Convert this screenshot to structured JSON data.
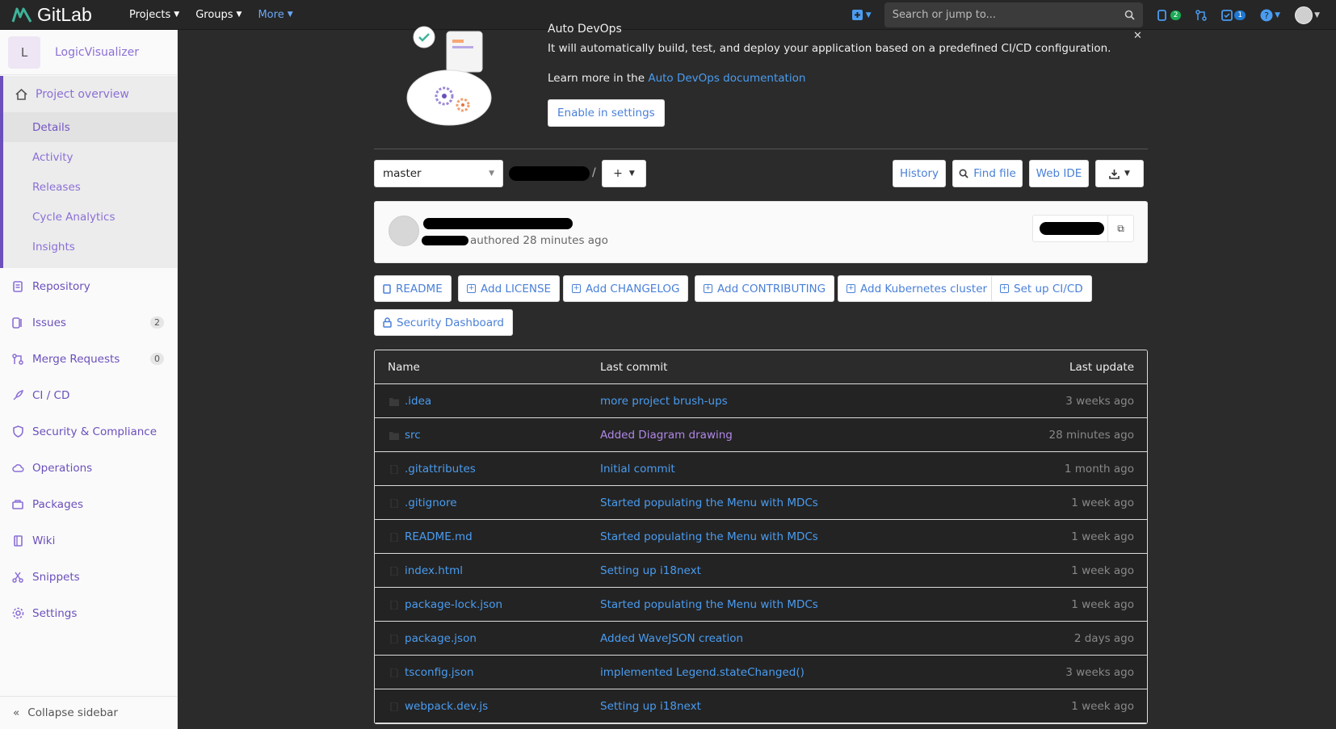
{
  "navbar": {
    "logo_text": "GitLab",
    "projects": "Projects",
    "groups": "Groups",
    "more": "More",
    "search_placeholder": "Search or jump to...",
    "issues_count": "2",
    "todos_count": "1"
  },
  "sidebar": {
    "project_letter": "L",
    "project_name": "LogicVisualizer",
    "overview": {
      "label": "Project overview",
      "items": [
        "Details",
        "Activity",
        "Releases",
        "Cycle Analytics",
        "Insights"
      ]
    },
    "items": [
      {
        "label": "Repository"
      },
      {
        "label": "Issues",
        "count": "2"
      },
      {
        "label": "Merge Requests",
        "count": "0"
      },
      {
        "label": "CI / CD"
      },
      {
        "label": "Security & Compliance"
      },
      {
        "label": "Operations"
      },
      {
        "label": "Packages"
      },
      {
        "label": "Wiki"
      },
      {
        "label": "Snippets"
      },
      {
        "label": "Settings"
      }
    ],
    "collapse": "Collapse sidebar"
  },
  "devops": {
    "title": "Auto DevOps",
    "text": "It will automatically build, test, and deploy your application based on a predefined CI/CD configuration.",
    "learn_prefix": "Learn more in the ",
    "learn_link": "Auto DevOps documentation",
    "enable_button": "Enable in settings"
  },
  "repo": {
    "branch": "master",
    "path_separator": "/",
    "history": "History",
    "find_file": "Find file",
    "web_ide": "Web IDE"
  },
  "commit": {
    "meta": "authored 28 minutes ago"
  },
  "shortcuts": [
    "README",
    "Add LICENSE",
    "Add CHANGELOG",
    "Add CONTRIBUTING",
    "Add Kubernetes cluster",
    "Set up CI/CD",
    "Security Dashboard"
  ],
  "files": {
    "headers": {
      "name": "Name",
      "last_commit": "Last commit",
      "last_update": "Last update"
    },
    "rows": [
      {
        "name": ".idea",
        "type": "folder",
        "commit": "more project brush-ups",
        "time": "3 weeks ago"
      },
      {
        "name": "src",
        "type": "folder",
        "commit": "Added Diagram drawing",
        "time": "28 minutes ago",
        "visited": true
      },
      {
        "name": ".gitattributes",
        "type": "file",
        "commit": "Initial commit",
        "time": "1 month ago"
      },
      {
        "name": ".gitignore",
        "type": "file",
        "commit": "Started populating the Menu with MDCs",
        "time": "1 week ago"
      },
      {
        "name": "README.md",
        "type": "file",
        "commit": "Started populating the Menu with MDCs",
        "time": "1 week ago"
      },
      {
        "name": "index.html",
        "type": "file",
        "commit": "Setting up i18next",
        "time": "1 week ago"
      },
      {
        "name": "package-lock.json",
        "type": "file",
        "commit": "Started populating the Menu with MDCs",
        "time": "1 week ago"
      },
      {
        "name": "package.json",
        "type": "file",
        "commit": "Added WaveJSON creation",
        "time": "2 days ago"
      },
      {
        "name": "tsconfig.json",
        "type": "file",
        "commit": "implemented Legend.stateChanged()",
        "time": "3 weeks ago"
      },
      {
        "name": "webpack.dev.js",
        "type": "file",
        "commit": "Setting up i18next",
        "time": "1 week ago"
      }
    ]
  },
  "colors": {
    "accent": "#6b4fbb",
    "link": "#4a9cf0",
    "nav_bg": "#262626"
  }
}
